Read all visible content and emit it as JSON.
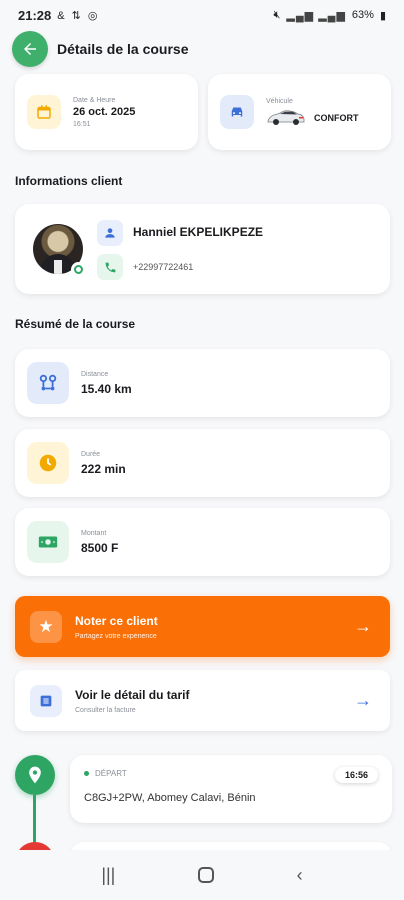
{
  "status_bar": {
    "time": "21:28",
    "left_icons": "& ⇅ ◎",
    "battery": "63%"
  },
  "header": {
    "title": "Détails de la course"
  },
  "date_card": {
    "label": "Date & Heure",
    "date": "26 oct. 2025",
    "time": "16:51"
  },
  "vehicle_card": {
    "label": "Véhicule",
    "name": "CONFORT"
  },
  "client_section": {
    "title": "Informations client",
    "name": "Hanniel EKPELIKPEZE",
    "phone": "+22997722461"
  },
  "summary_section": {
    "title": "Résumé de la course"
  },
  "stats": [
    {
      "label": "Distance",
      "value": "15.40 km"
    },
    {
      "label": "Durée",
      "value": "222 min"
    },
    {
      "label": "Montant",
      "value": "8500 F"
    }
  ],
  "rate_card": {
    "title": "Noter ce client",
    "subtitle": "Partagez votre expérience"
  },
  "tarif_card": {
    "title": "Voir le détail du tarif",
    "subtitle": "Consulter la facture"
  },
  "departure": {
    "label": "DÉPART",
    "address": "C8GJ+2PW, Abomey Calavi, Bénin",
    "time": "16:56"
  },
  "colors": {
    "accent_green": "#3fb06b",
    "accent_orange": "#fb6f07",
    "accent_blue": "#3c6fd8",
    "accent_red": "#e53935"
  }
}
